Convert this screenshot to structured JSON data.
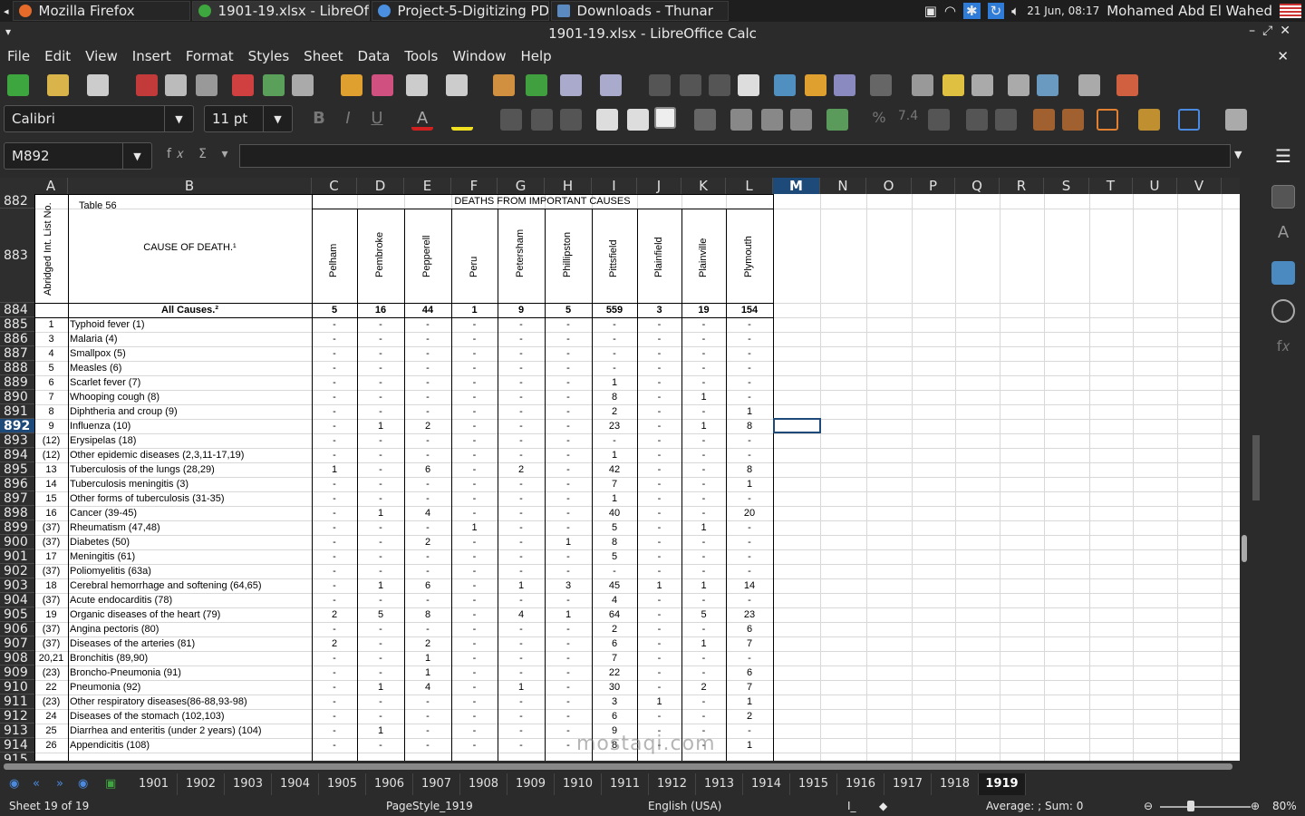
{
  "taskbar": {
    "items": [
      {
        "label": "Mozilla Firefox"
      },
      {
        "label": "1901-19.xlsx - LibreOffic..."
      },
      {
        "label": "Project-5-Digitizing PDF..."
      },
      {
        "label": "Downloads - Thunar"
      }
    ],
    "clock": "21 Jun, 08:17",
    "user": "Mohamed Abd El Wahed"
  },
  "window": {
    "title": "1901-19.xlsx - LibreOffice Calc"
  },
  "menu": [
    "File",
    "Edit",
    "View",
    "Insert",
    "Format",
    "Styles",
    "Sheet",
    "Data",
    "Tools",
    "Window",
    "Help"
  ],
  "toolbar": {
    "font_name": "Calibri",
    "font_size": "11 pt"
  },
  "formula": {
    "name_box": "M892",
    "content": ""
  },
  "columns": [
    "A",
    "B",
    "C",
    "D",
    "E",
    "F",
    "G",
    "H",
    "I",
    "J",
    "K",
    "L",
    "M",
    "N",
    "O",
    "P",
    "Q",
    "R",
    "S",
    "T",
    "U",
    "V"
  ],
  "sheet": {
    "table_label": "Table 56",
    "cause_header": "CAUSE OF DEATH.¹",
    "list_header": "Abridged Int. List No.",
    "group_header": "DEATHS FROM IMPORTANT CAUSES",
    "towns": [
      "Pelham",
      "Pembroke",
      "Pepperell",
      "Peru",
      "Petersham",
      "Phillipston",
      "Pittsfield",
      "Plainfield",
      "Plainville",
      "Plymouth"
    ],
    "all_causes": {
      "label": "All Causes.²",
      "values": [
        "5",
        "16",
        "44",
        "1",
        "9",
        "5",
        "559",
        "3",
        "19",
        "154"
      ]
    },
    "rows": [
      {
        "n": "885",
        "no": "1",
        "cause": "Typhoid fever (1)",
        "v": [
          "-",
          "-",
          "-",
          "-",
          "-",
          "-",
          "-",
          "-",
          "-",
          "-"
        ]
      },
      {
        "n": "886",
        "no": "3",
        "cause": "Malaria (4)",
        "v": [
          "-",
          "-",
          "-",
          "-",
          "-",
          "-",
          "-",
          "-",
          "-",
          "-"
        ]
      },
      {
        "n": "887",
        "no": "4",
        "cause": "Smallpox (5)",
        "v": [
          "-",
          "-",
          "-",
          "-",
          "-",
          "-",
          "-",
          "-",
          "-",
          "-"
        ]
      },
      {
        "n": "888",
        "no": "5",
        "cause": "Measles (6)",
        "v": [
          "-",
          "-",
          "-",
          "-",
          "-",
          "-",
          "-",
          "-",
          "-",
          "-"
        ]
      },
      {
        "n": "889",
        "no": "6",
        "cause": "Scarlet fever (7)",
        "v": [
          "-",
          "-",
          "-",
          "-",
          "-",
          "-",
          "1",
          "-",
          "-",
          "-"
        ]
      },
      {
        "n": "890",
        "no": "7",
        "cause": "Whooping cough (8)",
        "v": [
          "-",
          "-",
          "-",
          "-",
          "-",
          "-",
          "8",
          "-",
          "1",
          "-"
        ]
      },
      {
        "n": "891",
        "no": "8",
        "cause": "Diphtheria and croup (9)",
        "v": [
          "-",
          "-",
          "-",
          "-",
          "-",
          "-",
          "2",
          "-",
          "-",
          "1"
        ]
      },
      {
        "n": "892",
        "no": "9",
        "cause": "Influenza (10)",
        "v": [
          "-",
          "1",
          "2",
          "-",
          "-",
          "-",
          "23",
          "-",
          "1",
          "8"
        ]
      },
      {
        "n": "893",
        "no": "(12)",
        "cause": "Erysipelas (18)",
        "v": [
          "-",
          "-",
          "-",
          "-",
          "-",
          "-",
          "-",
          "-",
          "-",
          "-"
        ]
      },
      {
        "n": "894",
        "no": "(12)",
        "cause": "Other epidemic diseases (2,3,11-17,19)",
        "v": [
          "-",
          "-",
          "-",
          "-",
          "-",
          "-",
          "1",
          "-",
          "-",
          "-"
        ]
      },
      {
        "n": "895",
        "no": "13",
        "cause": "Tuberculosis of the lungs (28,29)",
        "v": [
          "1",
          "-",
          "6",
          "-",
          "2",
          "-",
          "42",
          "-",
          "-",
          "8"
        ]
      },
      {
        "n": "896",
        "no": "14",
        "cause": "Tuberculosis meningitis (3)",
        "v": [
          "-",
          "-",
          "-",
          "-",
          "-",
          "-",
          "7",
          "-",
          "-",
          "1"
        ]
      },
      {
        "n": "897",
        "no": "15",
        "cause": "Other forms of tuberculosis (31-35)",
        "v": [
          "-",
          "-",
          "-",
          "-",
          "-",
          "-",
          "1",
          "-",
          "-",
          "-"
        ]
      },
      {
        "n": "898",
        "no": "16",
        "cause": "Cancer (39-45)",
        "v": [
          "-",
          "1",
          "4",
          "-",
          "-",
          "-",
          "40",
          "-",
          "-",
          "20"
        ]
      },
      {
        "n": "899",
        "no": "(37)",
        "cause": "Rheumatism (47,48)",
        "v": [
          "-",
          "-",
          "-",
          "1",
          "-",
          "-",
          "5",
          "-",
          "1",
          "-"
        ]
      },
      {
        "n": "900",
        "no": "(37)",
        "cause": "Diabetes (50)",
        "v": [
          "-",
          "-",
          "2",
          "-",
          "-",
          "1",
          "8",
          "-",
          "-",
          "-"
        ]
      },
      {
        "n": "901",
        "no": "17",
        "cause": "Meningitis (61)",
        "v": [
          "-",
          "-",
          "-",
          "-",
          "-",
          "-",
          "5",
          "-",
          "-",
          "-"
        ]
      },
      {
        "n": "902",
        "no": "(37)",
        "cause": "Poliomyelitis (63a)",
        "v": [
          "-",
          "-",
          "-",
          "-",
          "-",
          "-",
          "-",
          "-",
          "-",
          "-"
        ]
      },
      {
        "n": "903",
        "no": "18",
        "cause": "Cerebral hemorrhage and softening (64,65)",
        "v": [
          "-",
          "1",
          "6",
          "-",
          "1",
          "3",
          "45",
          "1",
          "1",
          "14"
        ]
      },
      {
        "n": "904",
        "no": "(37)",
        "cause": "Acute endocarditis (78)",
        "v": [
          "-",
          "-",
          "-",
          "-",
          "-",
          "-",
          "4",
          "-",
          "-",
          "-"
        ]
      },
      {
        "n": "905",
        "no": "19",
        "cause": "Organic diseases of the heart (79)",
        "v": [
          "2",
          "5",
          "8",
          "-",
          "4",
          "1",
          "64",
          "-",
          "5",
          "23"
        ]
      },
      {
        "n": "906",
        "no": "(37)",
        "cause": "Angina pectoris (80)",
        "v": [
          "-",
          "-",
          "-",
          "-",
          "-",
          "-",
          "2",
          "-",
          "-",
          "6"
        ]
      },
      {
        "n": "907",
        "no": "(37)",
        "cause": "Diseases of the arteries (81)",
        "v": [
          "2",
          "-",
          "2",
          "-",
          "-",
          "-",
          "6",
          "-",
          "1",
          "7"
        ]
      },
      {
        "n": "908",
        "no": "20,21",
        "cause": "Bronchitis (89,90)",
        "v": [
          "-",
          "-",
          "1",
          "-",
          "-",
          "-",
          "7",
          "-",
          "-",
          "-"
        ]
      },
      {
        "n": "909",
        "no": "(23)",
        "cause": "Broncho-Pneumonia (91)",
        "v": [
          "-",
          "-",
          "1",
          "-",
          "-",
          "-",
          "22",
          "-",
          "-",
          "6"
        ]
      },
      {
        "n": "910",
        "no": "22",
        "cause": "Pneumonia (92)",
        "v": [
          "-",
          "1",
          "4",
          "-",
          "1",
          "-",
          "30",
          "-",
          "2",
          "7"
        ]
      },
      {
        "n": "911",
        "no": "(23)",
        "cause": "Other respiratory diseases(86-88,93-98)",
        "v": [
          "-",
          "-",
          "-",
          "-",
          "-",
          "-",
          "3",
          "1",
          "-",
          "1"
        ]
      },
      {
        "n": "912",
        "no": "24",
        "cause": "Diseases of the stomach (102,103)",
        "v": [
          "-",
          "-",
          "-",
          "-",
          "-",
          "-",
          "6",
          "-",
          "-",
          "2"
        ]
      },
      {
        "n": "913",
        "no": "25",
        "cause": "Diarrhea and enteritis (under 2 years) (104)",
        "v": [
          "-",
          "1",
          "-",
          "-",
          "-",
          "-",
          "9",
          "-",
          "-",
          "-"
        ]
      },
      {
        "n": "914",
        "no": "26",
        "cause": "Appendicitis (108)",
        "v": [
          "-",
          "-",
          "-",
          "-",
          "-",
          "-",
          "8",
          "-",
          "-",
          "1"
        ]
      }
    ]
  },
  "tabs": [
    "1901",
    "1902",
    "1903",
    "1904",
    "1905",
    "1906",
    "1907",
    "1908",
    "1909",
    "1910",
    "1911",
    "1912",
    "1913",
    "1914",
    "1915",
    "1916",
    "1917",
    "1918",
    "1919"
  ],
  "active_tab": "1919",
  "status": {
    "sheet": "Sheet 19 of 19",
    "page_style": "PageStyle_1919",
    "language": "English (USA)",
    "summary": "Average: ; Sum: 0",
    "zoom": "80%"
  },
  "watermark": "mostaqi.com"
}
